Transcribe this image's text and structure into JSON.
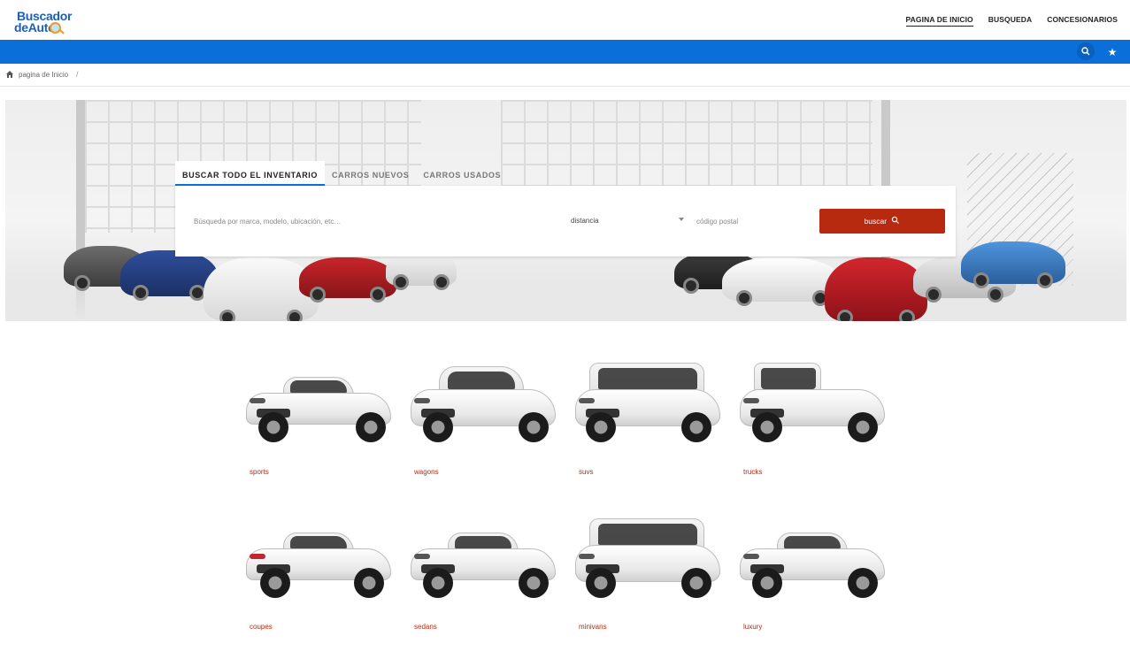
{
  "header": {
    "logo": {
      "line1": "Buscador",
      "line2": "deAuto"
    },
    "nav": [
      {
        "label": "PAGINA DE INICIO",
        "active": true
      },
      {
        "label": "BUSQUEDA",
        "active": false
      },
      {
        "label": "CONCESIONARIOS",
        "active": false
      }
    ],
    "bar_color": "#0a6fd8",
    "icons": [
      "search-icon",
      "star-icon"
    ]
  },
  "breadcrumb": {
    "home": "pagina de Inicio",
    "separator": "/"
  },
  "search": {
    "tabs": [
      {
        "label": "BUSCAR TODO EL INVENTARIO",
        "active": true
      },
      {
        "label": "CARROS NUEVOS",
        "active": false
      },
      {
        "label": "CARROS USADOS",
        "active": false
      }
    ],
    "query_placeholder": "Búsqueda por marca, modelo, ubicación, etc…",
    "distance_label": "distancia",
    "zip_placeholder": "código postal",
    "button_label": "buscar",
    "button_color": "#b82a10"
  },
  "categories": [
    {
      "label": "sports"
    },
    {
      "label": "wagons"
    },
    {
      "label": "suvs"
    },
    {
      "label": "trucks"
    },
    {
      "label": "coupes"
    },
    {
      "label": "sedans"
    },
    {
      "label": "minivans"
    },
    {
      "label": "luxury"
    }
  ]
}
